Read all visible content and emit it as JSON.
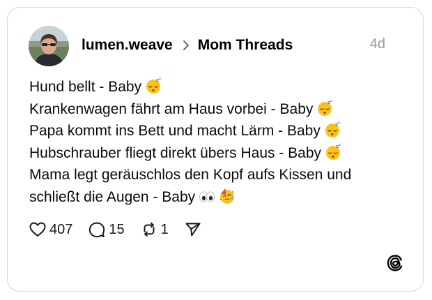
{
  "post": {
    "username": "lumen.weave",
    "community": "Mom Threads",
    "timestamp": "4d",
    "lines": [
      {
        "text": "Hund bellt - Baby",
        "emojis": [
          "sleeping-face"
        ]
      },
      {
        "text": "Krankenwagen fährt am Haus vorbei - Baby",
        "emojis": [
          "sleeping-face"
        ]
      },
      {
        "text": "Papa kommt ins Bett und macht Lärm - Baby",
        "emojis": [
          "sleeping-face"
        ]
      },
      {
        "text": "Hubschrauber fliegt direkt übers Haus - Baby",
        "emojis": [
          "sleeping-face"
        ]
      },
      {
        "text": "Mama legt geräuschlos den Kopf aufs Kissen und",
        "emojis": []
      },
      {
        "text": "schließt die Augen - Baby",
        "emojis": [
          "eyes",
          "partying-face"
        ]
      }
    ],
    "actions": {
      "likes": "407",
      "replies": "15",
      "reposts": "1"
    }
  },
  "icons": {
    "like": "heart-icon",
    "reply": "speech-bubble-icon",
    "repost": "repost-icon",
    "share": "send-icon",
    "brand": "threads-logo-icon"
  },
  "colors": {
    "border": "#d9d9d9",
    "timestamp": "#9a9a9a",
    "text": "#000000"
  }
}
